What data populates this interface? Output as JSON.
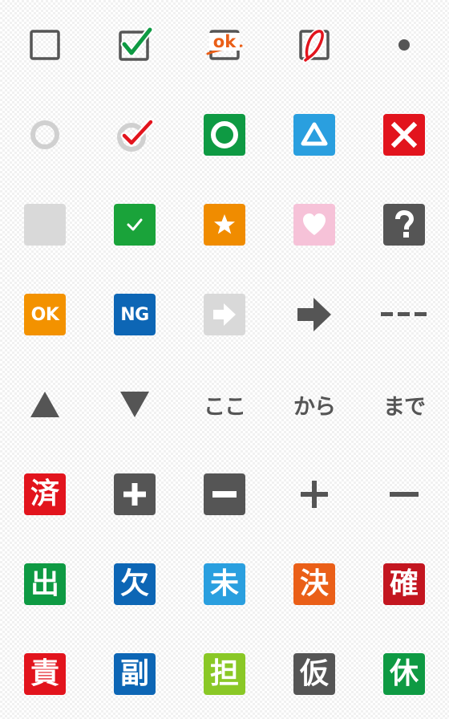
{
  "stamps": {
    "ok_scribble": "ok",
    "ok_badge": "OK",
    "ng_badge": "NG",
    "koko": "ここ",
    "kara": "から",
    "made": "まで",
    "kanji": [
      "済",
      "出",
      "欠",
      "未",
      "決",
      "確",
      "責",
      "副",
      "担",
      "仮",
      "休"
    ]
  },
  "colors": {
    "gray": "#555555",
    "light_gray": "#d9d9d9",
    "green": "#0e9a43",
    "red": "#e2141d",
    "sky": "#2a9fdf",
    "navy": "#0d66b5",
    "orange": "#ea5f18",
    "amber": "#f39200",
    "pink": "#f6c2d8",
    "lime": "#8ac826",
    "crimson": "#c31620"
  },
  "icons": [
    "empty-checkbox-icon",
    "checked-checkbox-icon",
    "ok-scribble-icon",
    "red-circle-scribble-icon",
    "dot-icon",
    "gray-ring-icon",
    "ring-check-icon",
    "green-circle-tile-icon",
    "blue-triangle-tile-icon",
    "red-x-tile-icon",
    "blank-gray-tile-icon",
    "green-check-tile-icon",
    "orange-star-tile-icon",
    "pink-heart-tile-icon",
    "question-tile-icon",
    "ok-badge",
    "ng-badge",
    "outline-arrow-tile-icon",
    "right-arrow-icon",
    "dashed-line-icon",
    "up-triangle-icon",
    "down-triangle-icon",
    "koko-text",
    "kara-text",
    "made-text",
    "sumi-kanji-tile",
    "plus-tile-icon",
    "minus-tile-icon",
    "plus-icon",
    "minus-icon",
    "de-kanji-tile",
    "ketsu-kanji-tile",
    "mi-kanji-tile",
    "kime-kanji-tile",
    "kaku-kanji-tile",
    "seki-kanji-tile",
    "fuku-kanji-tile",
    "tan-kanji-tile",
    "kari-kanji-tile",
    "yasumi-kanji-tile"
  ]
}
